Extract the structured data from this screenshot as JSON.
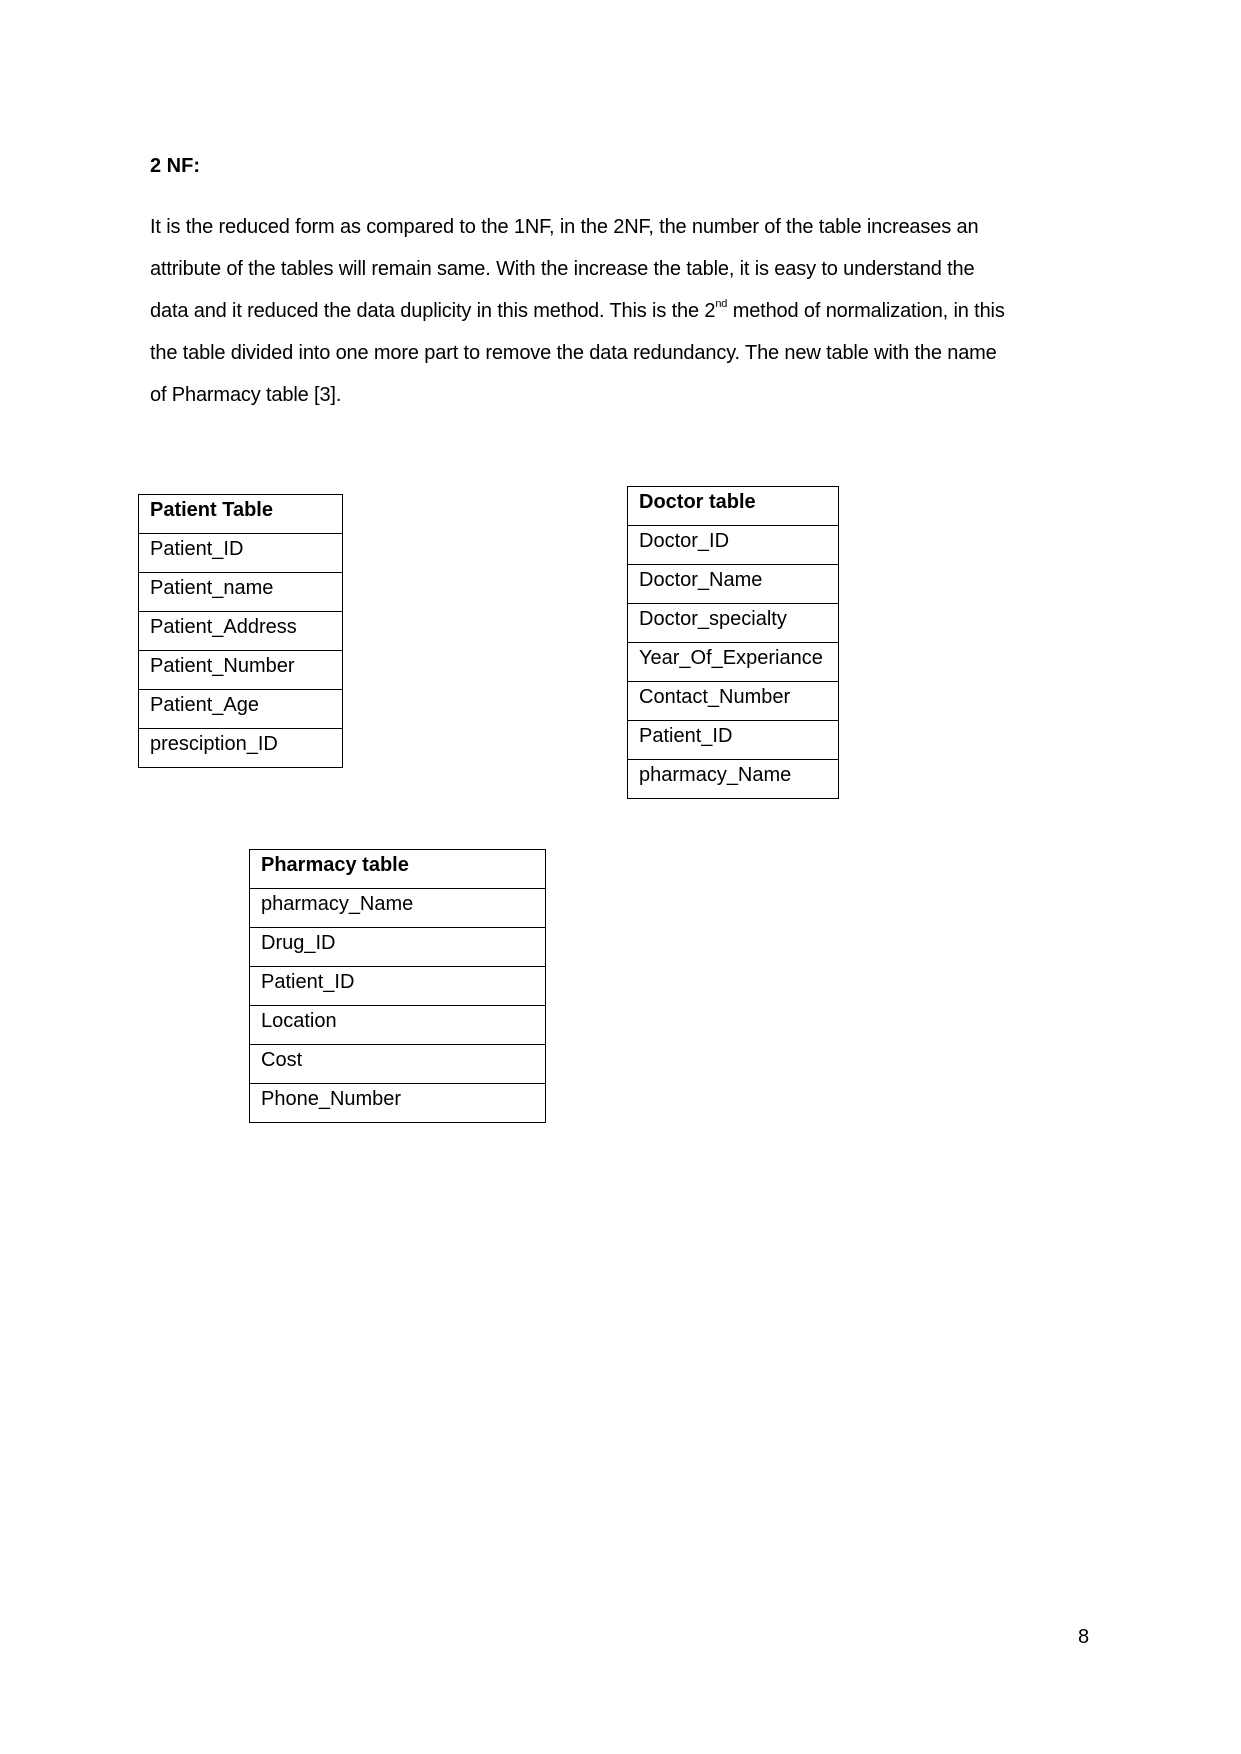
{
  "document": {
    "heading": "2 NF:",
    "paragraph": {
      "line1": "It is the reduced form as compared to the 1NF, in the 2NF, the number of the table increases an",
      "line2": "attribute of the tables will remain same. With the increase the table, it is easy to understand the",
      "line3_before": "data and it reduced the data duplicity in this method. This is the 2",
      "line3_sup": "nd",
      "line3_after": " method of normalization, in this",
      "line4": "the table divided into one more part to remove the data redundancy. The new table with the name",
      "line5": "of Pharmacy table [3]."
    },
    "tables": {
      "patient": {
        "title": "Patient Table",
        "fields": [
          "Patient_ID",
          "Patient_name",
          "Patient_Address",
          "Patient_Number",
          "Patient_Age",
          "presciption_ID"
        ]
      },
      "doctor": {
        "title": "Doctor table",
        "fields": [
          "Doctor_ID",
          "Doctor_Name",
          "Doctor_specialty",
          "Year_Of_Experiance",
          "Contact_Number",
          "Patient_ID",
          "pharmacy_Name"
        ]
      },
      "pharmacy": {
        "title": "Pharmacy table",
        "fields": [
          "pharmacy_Name",
          "Drug_ID",
          "Patient_ID",
          "Location",
          "Cost",
          "Phone_Number"
        ]
      }
    },
    "page_number": "8"
  }
}
